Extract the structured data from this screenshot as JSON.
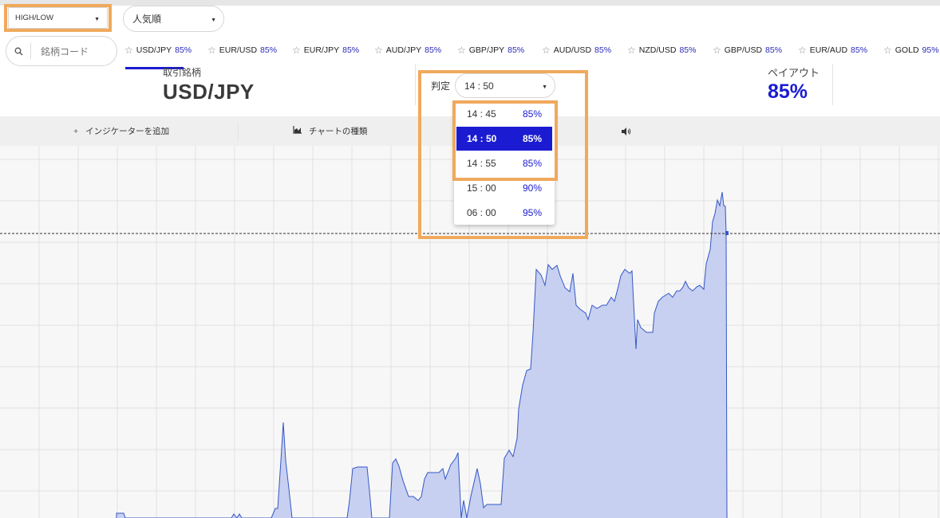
{
  "colors": {
    "accent": "#1b1bd1",
    "highlight": "#f0a95c",
    "chart_fill": "#c7d0f0",
    "chart_line": "#3457c8"
  },
  "trade_type": {
    "value": "HIGH/LOW"
  },
  "sort": {
    "value": "人気順"
  },
  "search": {
    "placeholder": "銘柄コード"
  },
  "ticker": [
    {
      "symbol": "USD/JPY",
      "payout": "85%"
    },
    {
      "symbol": "EUR/USD",
      "payout": "85%"
    },
    {
      "symbol": "EUR/JPY",
      "payout": "85%"
    },
    {
      "symbol": "AUD/JPY",
      "payout": "85%"
    },
    {
      "symbol": "GBP/JPY",
      "payout": "85%"
    },
    {
      "symbol": "AUD/USD",
      "payout": "85%"
    },
    {
      "symbol": "NZD/USD",
      "payout": "85%"
    },
    {
      "symbol": "GBP/USD",
      "payout": "85%"
    },
    {
      "symbol": "EUR/AUD",
      "payout": "85%"
    },
    {
      "symbol": "GOLD",
      "payout": "95%"
    }
  ],
  "asset": {
    "label": "取引銘柄",
    "name": "USD/JPY"
  },
  "expiry": {
    "label": "判定",
    "selected": "14 : 50",
    "options": [
      {
        "time": "14 : 45",
        "payout": "85%"
      },
      {
        "time": "14 : 50",
        "payout": "85%",
        "selected": true
      },
      {
        "time": "14 : 55",
        "payout": "85%"
      },
      {
        "time": "15 : 00",
        "payout": "90%"
      },
      {
        "time": "06 : 00",
        "payout": "95%"
      }
    ]
  },
  "payout": {
    "label": "ペイアウト",
    "value": "85%"
  },
  "toolbar": {
    "add_indicator": "インジケーターを追加",
    "chart_type": "チャートの種類",
    "sound_icon": "speaker-icon"
  }
}
